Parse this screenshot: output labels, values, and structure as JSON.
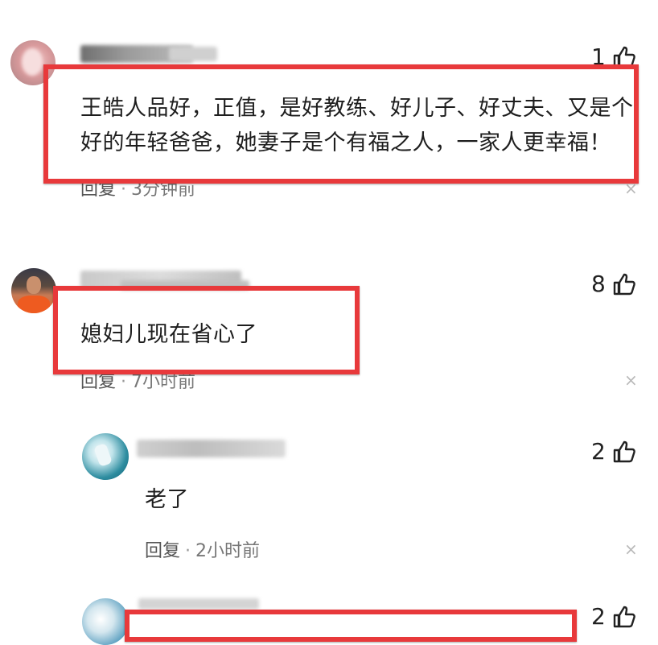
{
  "colors": {
    "highlight": "#e8393b",
    "meta_text": "#555555",
    "time_text": "#777777"
  },
  "comments": [
    {
      "text_lines": [
        "王皓人品好，正值，是好教练、好儿子、好丈夫、又是个",
        "好的年轻爸爸，她妻子是个有福之人，一家人更幸福！"
      ],
      "likes": "1",
      "reply_label": "回复",
      "time": "3分钟前",
      "highlighted": true
    },
    {
      "text_lines": [
        "媳妇儿现在省心了"
      ],
      "likes": "8",
      "reply_label": "回复",
      "time": "7小时前",
      "highlighted": true
    },
    {
      "text_lines": [
        "老了"
      ],
      "likes": "2",
      "reply_label": "回复",
      "time": "2小时前",
      "highlighted": false
    },
    {
      "text_lines": [],
      "likes": "2",
      "highlighted": true
    }
  ],
  "icons": {
    "like": "thumbs-up-icon",
    "dismiss": "close-icon"
  },
  "dismiss_glyph": "×",
  "separator": "·"
}
